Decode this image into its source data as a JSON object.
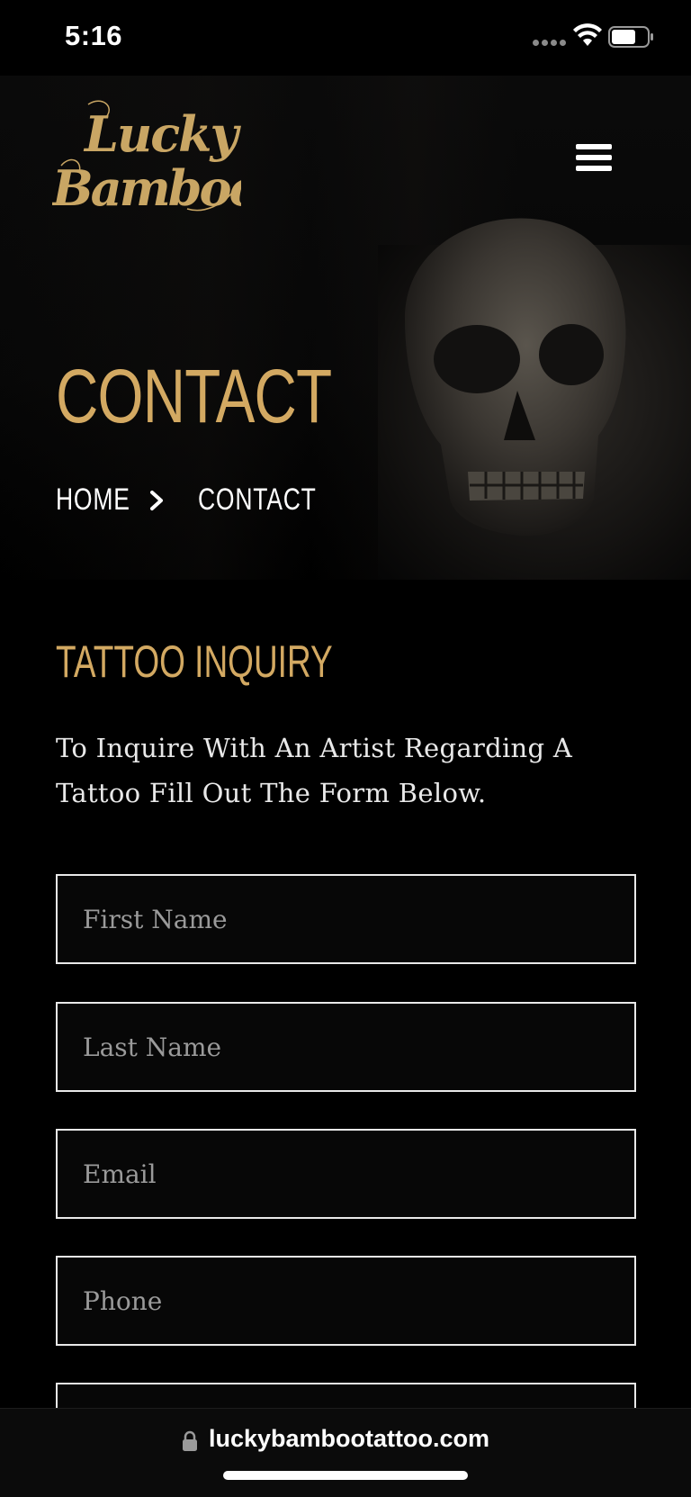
{
  "status_bar": {
    "time": "5:16"
  },
  "header": {
    "logo_line1": "Lucky",
    "logo_line2": "Bamboo",
    "menu_icon": "hamburger-icon"
  },
  "hero": {
    "title": "CONTACT",
    "breadcrumb": [
      {
        "label": "HOME"
      },
      {
        "label": "CONTACT"
      }
    ],
    "separator_icon": "chevron-right-icon"
  },
  "inquiry": {
    "title": "TATTOO INQUIRY",
    "description": "To Inquire With An Artist Regarding A Tattoo Fill Out The Form Below.",
    "fields": [
      {
        "placeholder": "First Name",
        "value": ""
      },
      {
        "placeholder": "Last Name",
        "value": ""
      },
      {
        "placeholder": "Email",
        "value": ""
      },
      {
        "placeholder": "Phone",
        "value": ""
      },
      {
        "placeholder": "",
        "value": ""
      }
    ]
  },
  "browser": {
    "url": "luckybambootattoo.com",
    "lock_icon": "lock-icon"
  },
  "colors": {
    "accent": "#d3a962",
    "background": "#000000",
    "field_border": "#e9e9e9"
  }
}
